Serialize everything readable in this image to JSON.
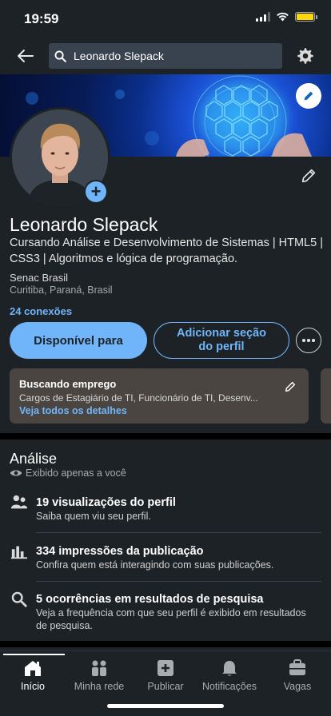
{
  "status_bar": {
    "time": "19:59"
  },
  "header": {
    "back_icon": "arrow-left-icon",
    "search_query": "Leonardo Slepack",
    "settings_icon": "gear-icon"
  },
  "profile": {
    "name": "Leonardo Slepack",
    "headline": "Cursando Análise e Desenvolvimento de Sistemas |  HTML5 | CSS3 | Algoritmos e lógica de programação.",
    "company": "Senac Brasil",
    "location": "Curitiba, Paraná, Brasil",
    "connections": "24 conexões"
  },
  "actions": {
    "primary_label": "Disponível para",
    "secondary_label": "Adicionar seção do perfil"
  },
  "open_to_work": {
    "title": "Buscando emprego",
    "roles": "Cargos de Estagiário de TI, Funcionário de TI, Desenv...",
    "link": "Veja todos os detalhes"
  },
  "analytics": {
    "title": "Análise",
    "private_note": "Exibido apenas a você",
    "items": [
      {
        "title": "19 visualizações do perfil",
        "subtitle": "Saiba quem viu seu perfil.",
        "icon": "people-icon"
      },
      {
        "title": "334 impressões da publicação",
        "subtitle": "Confira quem está interagindo com suas publicações.",
        "icon": "bar-chart-icon"
      },
      {
        "title": "5 ocorrências em resultados de pesquisa",
        "subtitle": "Veja a frequência com que seu perfil é exibido em resultados de pesquisa.",
        "icon": "search-icon"
      }
    ]
  },
  "bottom_nav": {
    "items": [
      {
        "label": "Início",
        "icon": "home-icon",
        "active": true
      },
      {
        "label": "Minha rede",
        "icon": "network-icon",
        "active": false
      },
      {
        "label": "Publicar",
        "icon": "post-icon",
        "active": false
      },
      {
        "label": "Notificações",
        "icon": "bell-icon",
        "active": false
      },
      {
        "label": "Vagas",
        "icon": "briefcase-icon",
        "active": false
      }
    ]
  },
  "colors": {
    "background": "#1d2226",
    "accent": "#70b5f9",
    "card": "#4a4540"
  }
}
